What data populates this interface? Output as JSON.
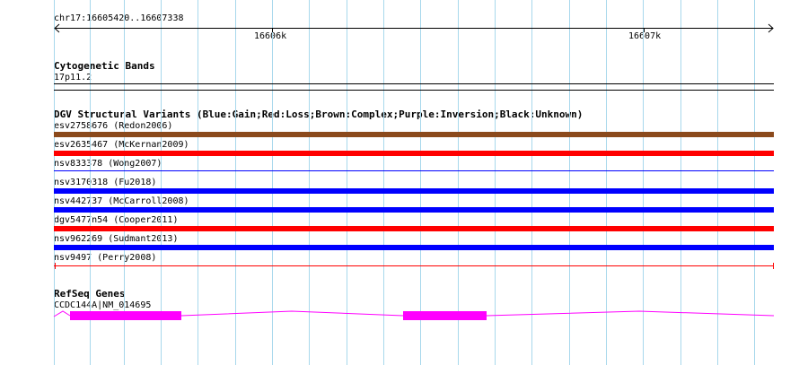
{
  "ruler": {
    "region": "chr17:16605420..16607338",
    "ticks": [
      "16606k",
      "16607k"
    ]
  },
  "cytoband": {
    "title": "Cytogenetic Bands",
    "band": "17p11.2"
  },
  "dgv": {
    "title": "DGV Structural Variants (Blue:Gain;Red:Loss;Brown:Complex;Purple:Inversion;Black:Unknown)",
    "variants": [
      {
        "label": "esv2758676 (Redon2006)",
        "type": "complex",
        "color": "#8b4a1c"
      },
      {
        "label": "esv2635467 (McKernan2009)",
        "type": "loss",
        "color": "#ff0000"
      },
      {
        "label": "nsv833378 (Wong2007)",
        "type": "gain",
        "color": "#0000ff"
      },
      {
        "label": "nsv3170318 (Fu2018)",
        "type": "gain",
        "color": "#0000ff"
      },
      {
        "label": "nsv442737 (McCarroll2008)",
        "type": "gain",
        "color": "#0000ff"
      },
      {
        "label": "dgv5477n54 (Cooper2011)",
        "type": "loss",
        "color": "#ff0000"
      },
      {
        "label": "nsv962269 (Sudmant2013)",
        "type": "gain",
        "color": "#0000ff"
      },
      {
        "label": "nsv9497 (Perry2008)",
        "type": "loss",
        "color": "#ff0000"
      }
    ]
  },
  "refseq": {
    "title": "RefSeq Genes",
    "gene": "CCDC144A|NM_014695",
    "color": "#ff00ff"
  },
  "colors": {
    "grid": "#a8d8ec",
    "axis": "#000000"
  }
}
